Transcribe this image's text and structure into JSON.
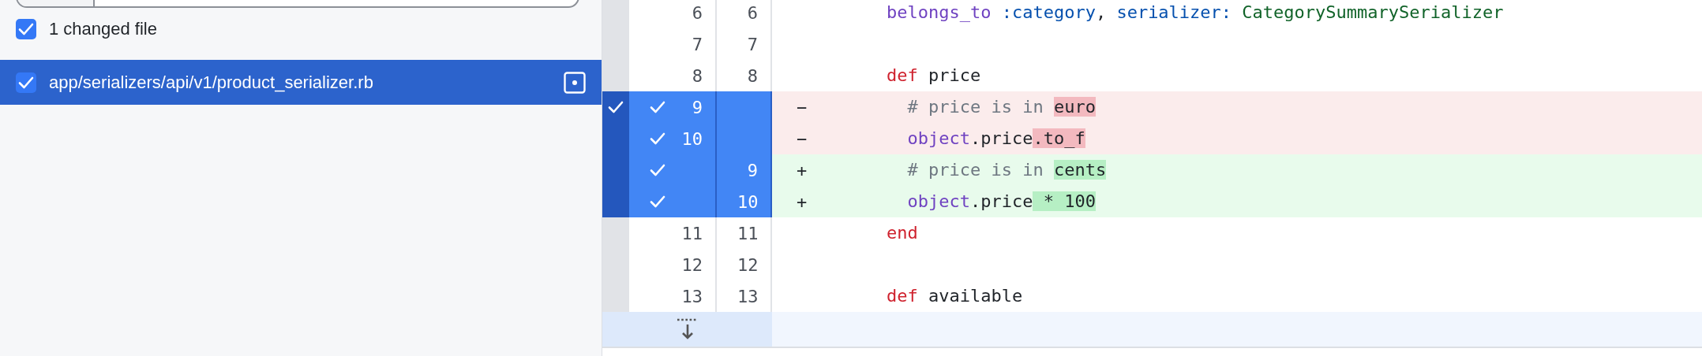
{
  "sidebar": {
    "select_all": {
      "label": "1 changed file",
      "checked": true
    },
    "files": [
      {
        "path": "app/serializers/api/v1/product_serializer.rb",
        "checked": true,
        "selected": true
      }
    ]
  },
  "diff": {
    "hunk_checked": true,
    "rows": [
      {
        "kind": "context",
        "old": "6",
        "new": "6",
        "selected": false,
        "tokens": [
          {
            "text": "    belongs_to",
            "kind": "method"
          },
          {
            "text": " :category",
            "kind": "symbol"
          },
          {
            "text": ", ",
            "kind": "plain"
          },
          {
            "text": "serializer:",
            "kind": "symbol"
          },
          {
            "text": " CategorySummarySerializer",
            "kind": "constant"
          }
        ]
      },
      {
        "kind": "context",
        "old": "7",
        "new": "7",
        "selected": false,
        "tokens": []
      },
      {
        "kind": "context",
        "old": "8",
        "new": "8",
        "selected": false,
        "tokens": [
          {
            "text": "    def",
            "kind": "keyword"
          },
          {
            "text": " price",
            "kind": "plain"
          }
        ]
      },
      {
        "kind": "deletion",
        "old": "9",
        "marker": "−",
        "selected": true,
        "tokens": [
          {
            "text": "      # price is in ",
            "kind": "comment"
          },
          {
            "text": "euro",
            "kind": "plain",
            "highlight": true
          }
        ]
      },
      {
        "kind": "deletion",
        "old": "10",
        "marker": "−",
        "selected": true,
        "tokens": [
          {
            "text": "      object",
            "kind": "method"
          },
          {
            "text": ".price",
            "kind": "plain"
          },
          {
            "text": ".to_f",
            "kind": "plain",
            "highlight": true
          }
        ]
      },
      {
        "kind": "addition",
        "new": "9",
        "marker": "+",
        "selected": true,
        "tokens": [
          {
            "text": "      # price is in ",
            "kind": "comment"
          },
          {
            "text": "cents",
            "kind": "plain",
            "highlight": true
          }
        ]
      },
      {
        "kind": "addition",
        "new": "10",
        "marker": "+",
        "selected": true,
        "tokens": [
          {
            "text": "      object",
            "kind": "method"
          },
          {
            "text": ".price",
            "kind": "plain"
          },
          {
            "text": " * 100",
            "kind": "plain",
            "highlight": true
          }
        ]
      },
      {
        "kind": "context",
        "old": "11",
        "new": "11",
        "selected": false,
        "tokens": [
          {
            "text": "    end",
            "kind": "keyword"
          }
        ]
      },
      {
        "kind": "context",
        "old": "12",
        "new": "12",
        "selected": false,
        "tokens": []
      },
      {
        "kind": "context",
        "old": "13",
        "new": "13",
        "selected": false,
        "tokens": [
          {
            "text": "    def",
            "kind": "keyword"
          },
          {
            "text": " available",
            "kind": "plain"
          }
        ]
      },
      {
        "kind": "expander",
        "tokens": []
      }
    ]
  }
}
